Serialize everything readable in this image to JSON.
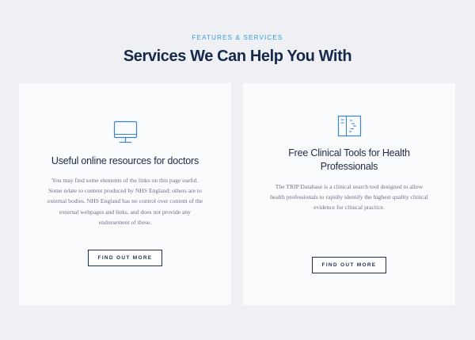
{
  "section": {
    "eyebrow": "FEATURES & SERVICES",
    "title": "Services We Can Help You With"
  },
  "cards": [
    {
      "icon": "monitor-icon",
      "title": "Useful online resources for doctors",
      "description_lines": [
        "You may find some elements of the links on this page useful.",
        "Some relate to content produced by NHS England; others are to",
        "external bodies. NHS England has no control over content of the",
        "external webpages and links, and does not provide any",
        "endorsement of these."
      ],
      "button_label": "FIND OUT MORE"
    },
    {
      "icon": "clinical-tools-icon",
      "title_lines": [
        "Free Clinical Tools for Health",
        "Professionals"
      ],
      "description_lines": [
        "The TRIP Database is a clinical search tool designed to allow",
        "health professionals to rapidly identify the highest quality clinical",
        "evidence for clinical practice."
      ],
      "button_label": "FIND OUT MORE"
    }
  ],
  "colors": {
    "accent": "#3a9ad9",
    "heading": "#16294a",
    "button_border": "#1f2f52",
    "background": "#eef0f4",
    "card": "#fafbfd"
  }
}
